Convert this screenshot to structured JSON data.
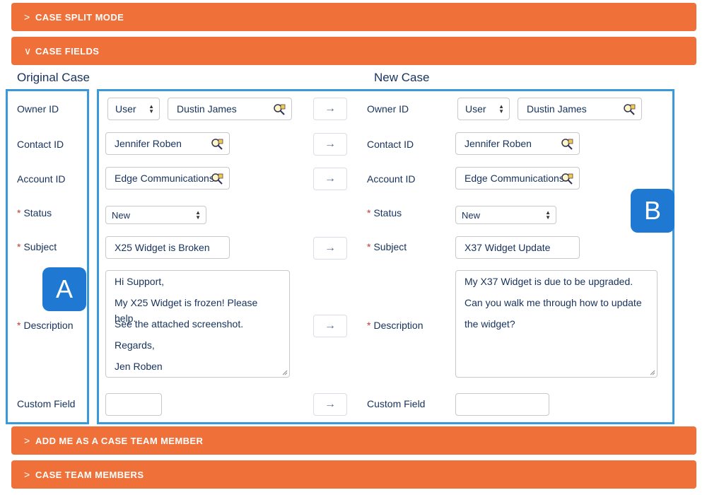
{
  "sections": {
    "split_mode": {
      "label": "CASE SPLIT MODE",
      "chevron": ">"
    },
    "case_fields": {
      "label": "CASE FIELDS",
      "chevron": "∨"
    },
    "add_me": {
      "label": "ADD ME AS A CASE TEAM MEMBER",
      "chevron": ">"
    },
    "team_members": {
      "label": "CASE TEAM MEMBERS",
      "chevron": ">"
    }
  },
  "headings": {
    "original": "Original Case",
    "new": "New Case"
  },
  "badges": {
    "a": "A",
    "b": "B"
  },
  "arrow_glyph": "→",
  "required_mark": "*",
  "labels": {
    "owner_id": "Owner ID",
    "contact_id": "Contact ID",
    "account_id": "Account ID",
    "status": "Status",
    "subject": "Subject",
    "description": "Description",
    "custom_field": "Custom Field"
  },
  "original": {
    "owner_type": "User",
    "owner_name": "Dustin James",
    "contact": "Jennifer Roben",
    "account": "Edge Communications",
    "status": "New",
    "subject": "X25 Widget is Broken",
    "description": [
      "Hi Support,",
      "My X25 Widget is frozen! Please help.",
      "See the attached screenshot.",
      "Regards,",
      "Jen Roben"
    ],
    "custom_field": ""
  },
  "new_case": {
    "owner_type": "User",
    "owner_name": "Dustin James",
    "contact": "Jennifer Roben",
    "account": "Edge Communications",
    "status": "New",
    "subject": "X37 Widget Update",
    "description": [
      "My X37 Widget is due to be upgraded.",
      "Can you walk me through how to update",
      "the widget?"
    ],
    "custom_field": ""
  },
  "colors": {
    "section_bar": "#ef7038",
    "frame": "#3a9ad9",
    "badge": "#1f78d1",
    "required": "#c23934"
  }
}
